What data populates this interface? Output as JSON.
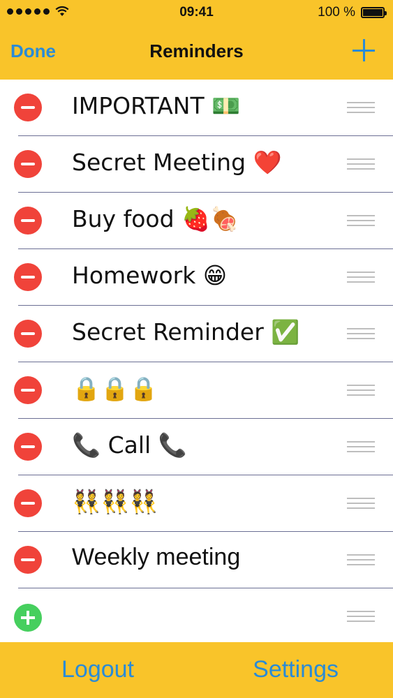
{
  "status_bar": {
    "time": "09:41",
    "battery": "100 %"
  },
  "nav": {
    "done_label": "Done",
    "title": "Reminders",
    "add_icon": "plus-icon"
  },
  "reminders": [
    {
      "label": "IMPORTANT 💵"
    },
    {
      "label": "Secret Meeting ❤️"
    },
    {
      "label": "Buy food 🍓🍖"
    },
    {
      "label": "Homework 😁"
    },
    {
      "label": "Secret Reminder ✅"
    },
    {
      "label": "🔒🔒🔒"
    },
    {
      "label": "📞 Call 📞"
    },
    {
      "label": "👯👯👯"
    },
    {
      "label": "Weekly meeting"
    }
  ],
  "bottom_bar": {
    "logout_label": "Logout",
    "settings_label": "Settings"
  },
  "colors": {
    "bar": "#F9C42A",
    "accent": "#2A8BD6",
    "delete": "#F0433A",
    "add": "#46CF5E",
    "separator": "#6B6F94"
  }
}
